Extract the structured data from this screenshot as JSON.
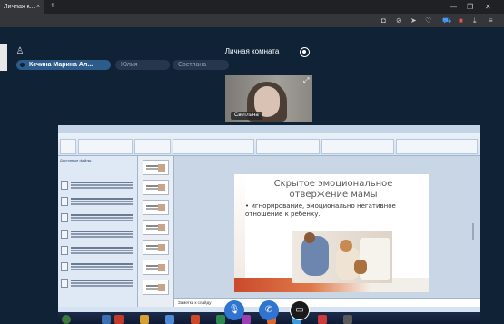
{
  "browser": {
    "tab_title": "Личная к...",
    "tab_close": "×",
    "new_tab": "+"
  },
  "room": {
    "title": "Личная комната"
  },
  "participants": [
    {
      "name": "Кечина Марина Ал..."
    },
    {
      "name": "Юлия"
    },
    {
      "name": "Светлана"
    }
  ],
  "video": {
    "name_tag": "Светлана"
  },
  "shared_screen": {
    "slide_title_line1": "Скрытое эмоциональное",
    "slide_title_line2": "отвержение мамы",
    "slide_bullet": "• игнорирование, эмоционально негативное отношение к ребенку.",
    "pane_header": "Доступные файлы",
    "notes_placeholder": "Заметки к слайду"
  },
  "colors": {
    "background": "#0f2236",
    "primary_button": "#2f74d0",
    "active_chip": "#2d5b8a"
  },
  "icons": {
    "user": "user-icon",
    "eye": "eye-icon",
    "mic": "mic-icon",
    "phone": "phone-icon",
    "screen_share": "screen-share-icon",
    "expand": "expand-icon"
  }
}
